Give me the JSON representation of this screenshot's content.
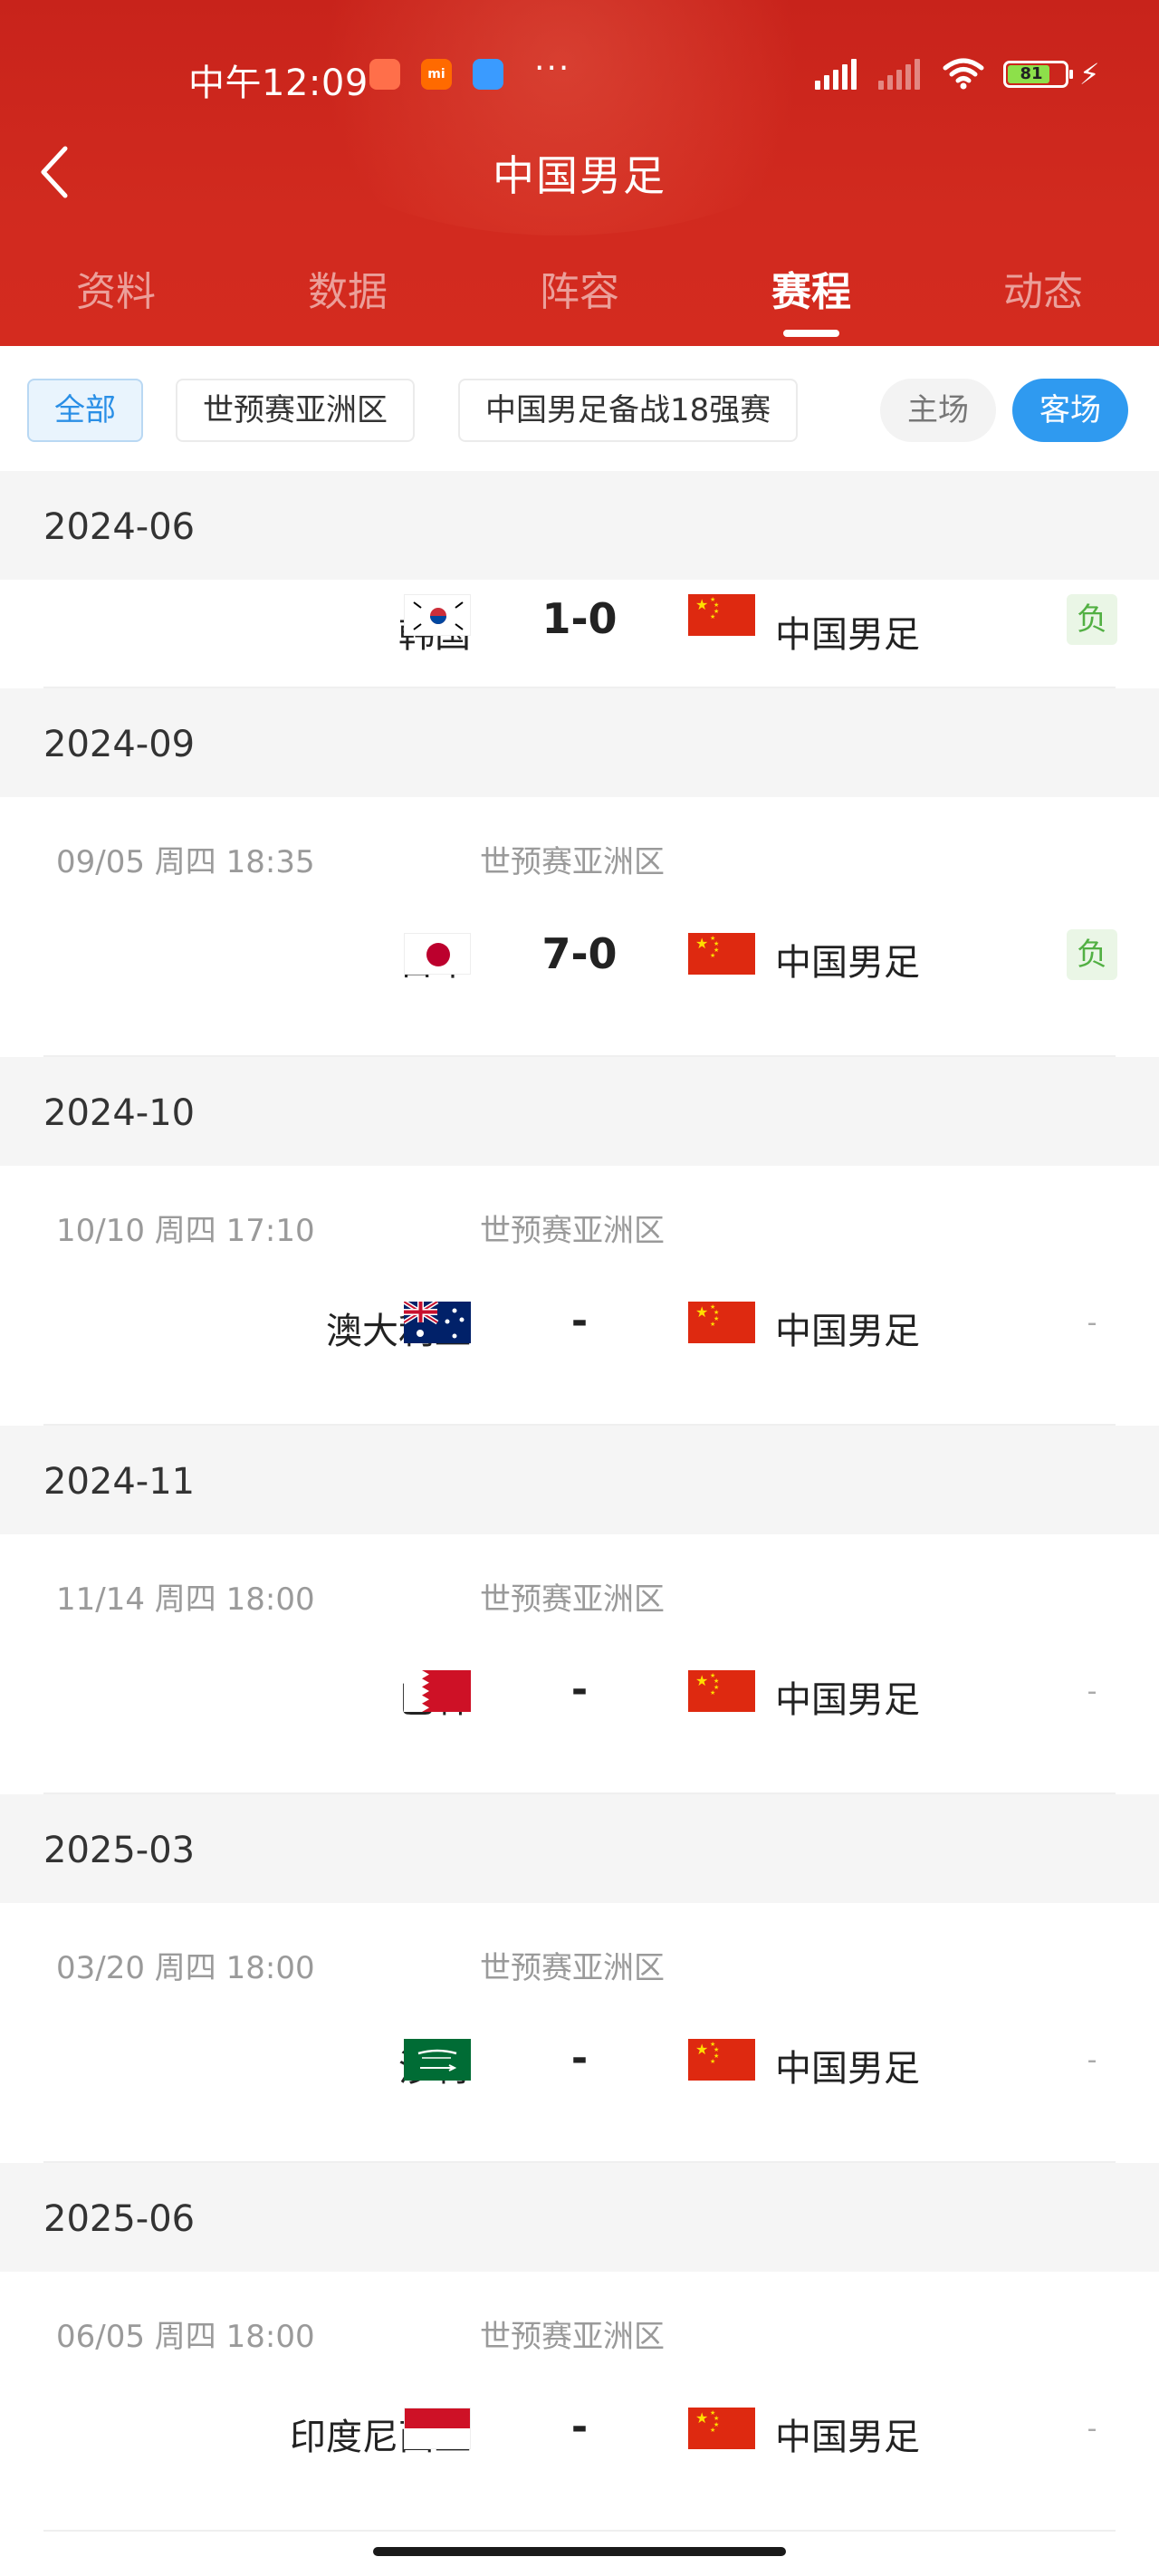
{
  "status_bar": {
    "time": "中午12:09",
    "mi_label": "mi",
    "dots": "···",
    "battery": "81"
  },
  "header": {
    "title": "中国男足",
    "tabs": [
      "资料",
      "数据",
      "阵容",
      "赛程",
      "动态"
    ],
    "active_tab": "赛程"
  },
  "filters": {
    "chips": [
      "全部",
      "世预赛亚洲区",
      "中国男足备战18强赛"
    ],
    "active_chip": "全部",
    "venue": [
      "主场",
      "客场"
    ],
    "active_venue": "客场"
  },
  "groups": [
    {
      "month": "2024-06",
      "match": {
        "date": "",
        "competition": "",
        "home": "韩国",
        "home_flag": "south-korea-flag-icon",
        "score": "1-0",
        "away": "中国男足",
        "result": "负"
      }
    },
    {
      "month": "2024-09",
      "match": {
        "date": "09/05  周四 18:35",
        "competition": "世预赛亚洲区",
        "home": "日本",
        "home_flag": "japan-flag-icon",
        "score": "7-0",
        "away": "中国男足",
        "result": "负"
      }
    },
    {
      "month": "2024-10",
      "match": {
        "date": "10/10  周四 17:10",
        "competition": "世预赛亚洲区",
        "home": "澳大利亚",
        "home_flag": "australia-flag-icon",
        "score": "-",
        "away": "中国男足",
        "result": "-"
      }
    },
    {
      "month": "2024-11",
      "match": {
        "date": "11/14  周四 18:00",
        "competition": "世预赛亚洲区",
        "home": "巴林",
        "home_flag": "bahrain-flag-icon",
        "score": "-",
        "away": "中国男足",
        "result": "-"
      }
    },
    {
      "month": "2025-03",
      "match": {
        "date": "03/20  周四 18:00",
        "competition": "世预赛亚洲区",
        "home": "沙特",
        "home_flag": "saudi-arabia-flag-icon",
        "score": "-",
        "away": "中国男足",
        "result": "-"
      }
    },
    {
      "month": "2025-06",
      "match": {
        "date": "06/05  周四 18:00",
        "competition": "世预赛亚洲区",
        "home": "印度尼西亚",
        "home_flag": "indonesia-flag-icon",
        "score": "-",
        "away": "中国男足",
        "result": "-"
      }
    }
  ],
  "colors": {
    "header_red": "#d12a1f",
    "accent_blue": "#2f9af0",
    "loss_green": "#52b043"
  }
}
